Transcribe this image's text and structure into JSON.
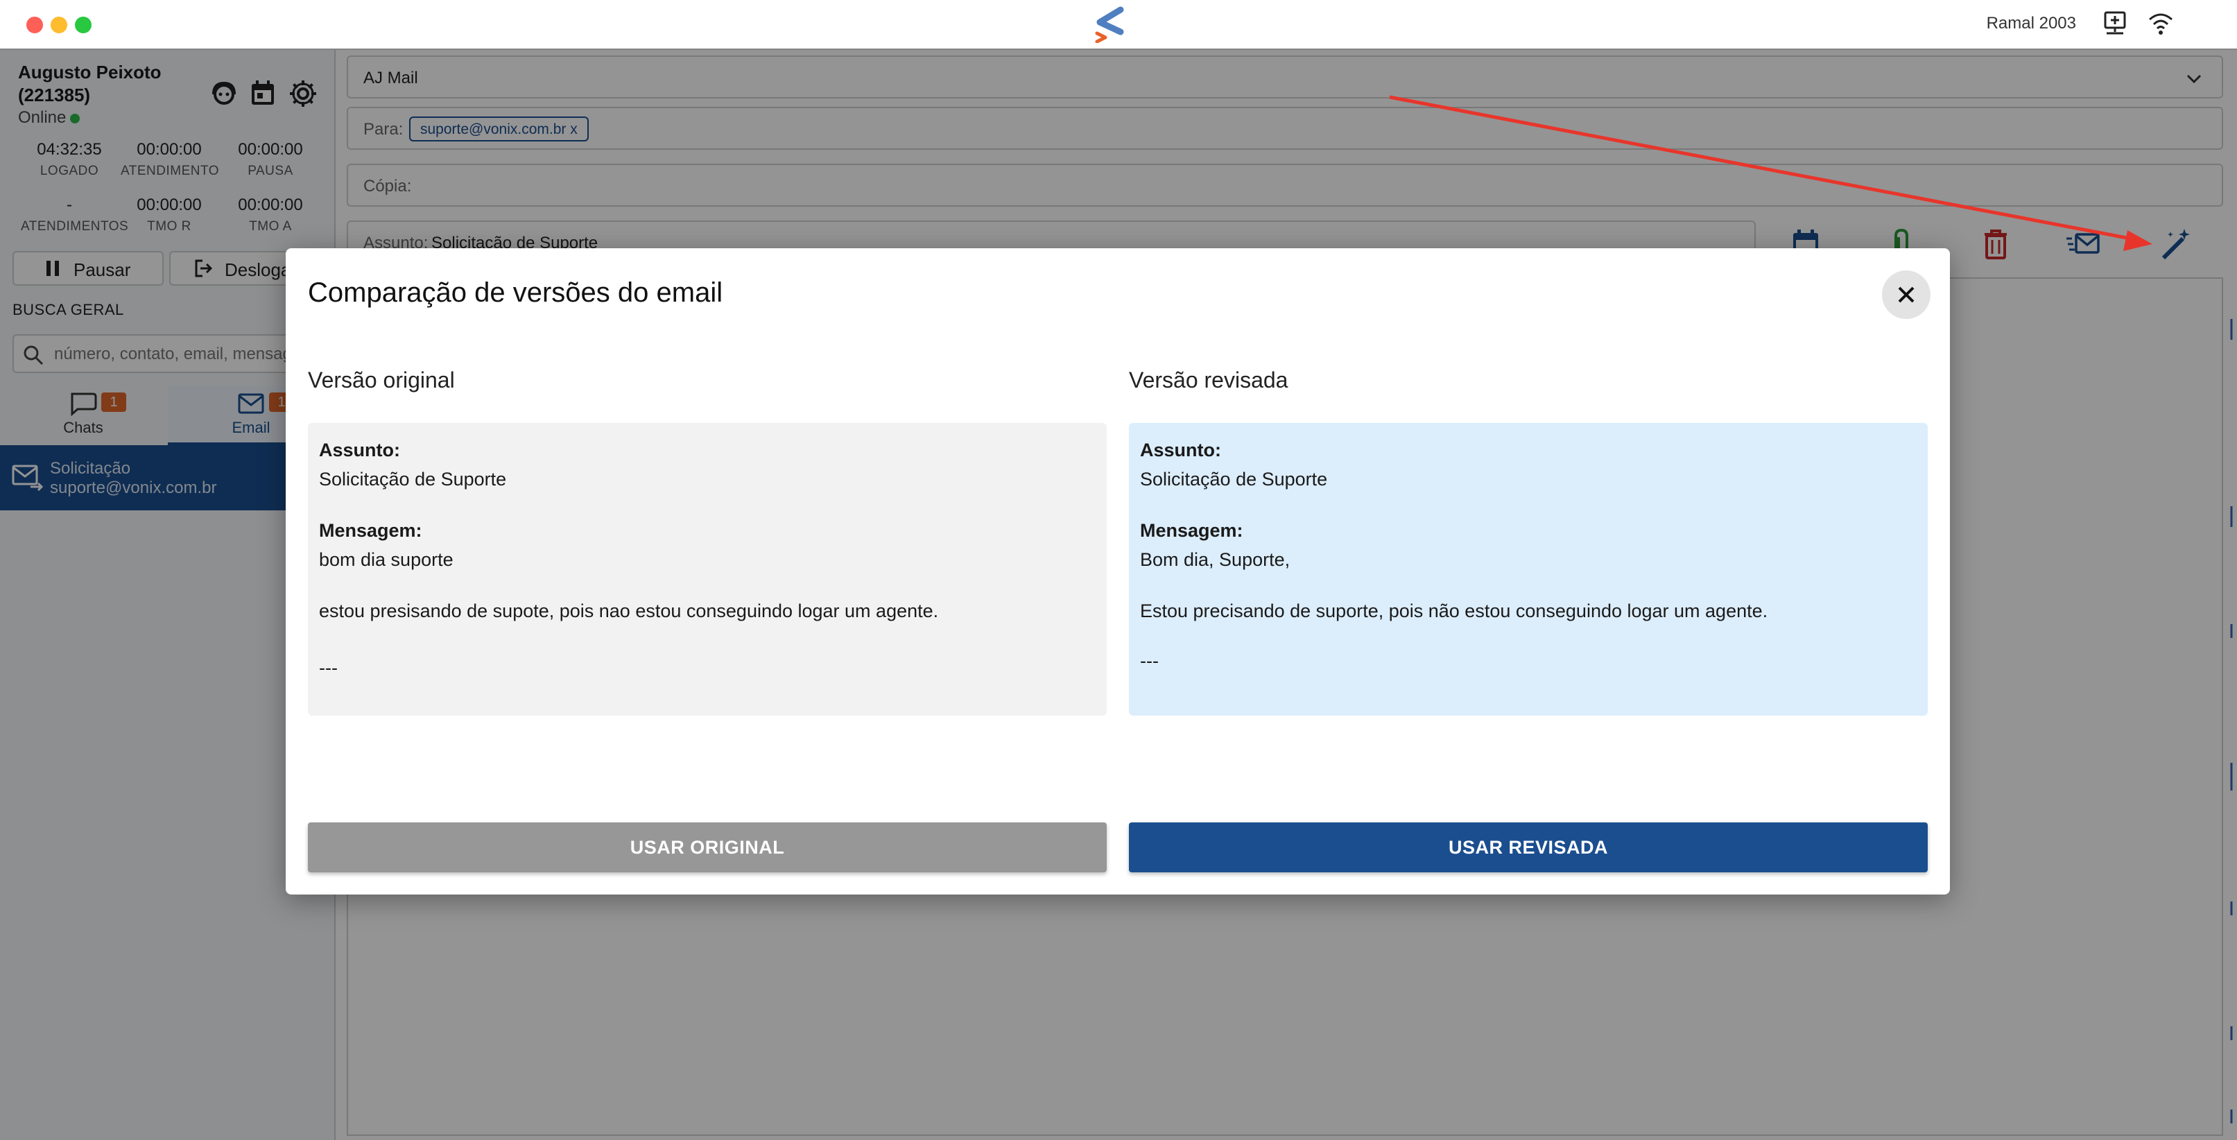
{
  "titlebar": {
    "ramal": "Ramal 2003",
    "icons": [
      "app-logo",
      "network-icon",
      "wifi-icon"
    ]
  },
  "sidebar": {
    "agent_name": "Augusto Peixoto (221385)",
    "status": "Online",
    "status_color": "#2eb84b",
    "header_icons": [
      "support-agent-icon",
      "calendar-icon",
      "gear-icon"
    ],
    "metrics": [
      {
        "value": "04:32:35",
        "label": "LOGADO"
      },
      {
        "value": "00:00:00",
        "label": "ATENDIMENTO"
      },
      {
        "value": "00:00:00",
        "label": "PAUSA"
      },
      {
        "value": "-",
        "label": "ATENDIMENTOS"
      },
      {
        "value": "00:00:00",
        "label": "TMO R"
      },
      {
        "value": "00:00:00",
        "label": "TMO A"
      }
    ],
    "pause_label": "Pausar",
    "logout_label": "Desloga",
    "search_title": "BUSCA GERAL",
    "search_placeholder": "número, contato, email, mensag",
    "tabs": [
      {
        "label": "Chats",
        "badge": "1",
        "icon": "chat-bubble-icon"
      },
      {
        "label": "Email",
        "badge": "1",
        "icon": "mail-icon"
      }
    ],
    "conversation": {
      "subject": "Solicitação",
      "email": "suporte@vonix.com.br"
    }
  },
  "compose": {
    "account": "AJ Mail",
    "to_label": "Para:",
    "to_chip": "suporte@vonix.com.br  x",
    "cc_label": "Cópia:",
    "subject_label": "Assunto:",
    "subject_value": "Solicitação de Suporte",
    "toolbar_icons": [
      "schedule-icon",
      "attach-icon",
      "delete-icon",
      "send-mail-icon",
      "magic-wand-icon"
    ]
  },
  "accent_color": "#1b4e8f",
  "annotation_arrow_color": "#e8352b",
  "modal": {
    "title": "Comparação de versões do email",
    "original": {
      "heading": "Versão original",
      "subject_label": "Assunto:",
      "subject": "Solicitação de Suporte",
      "message_label": "Mensagem:",
      "greeting": "bom dia suporte",
      "body": "estou presisando de supote, pois nao estou conseguindo logar um agente.",
      "signature": "---"
    },
    "revised": {
      "heading": "Versão revisada",
      "subject_label": "Assunto:",
      "subject": "Solicitação de Suporte",
      "message_label": "Mensagem:",
      "greeting": "Bom dia, Suporte,",
      "body": "Estou precisando de suporte, pois não estou conseguindo logar um agente.",
      "signature": "---"
    },
    "use_original": "USAR ORIGINAL",
    "use_revised": "USAR REVISADA"
  }
}
